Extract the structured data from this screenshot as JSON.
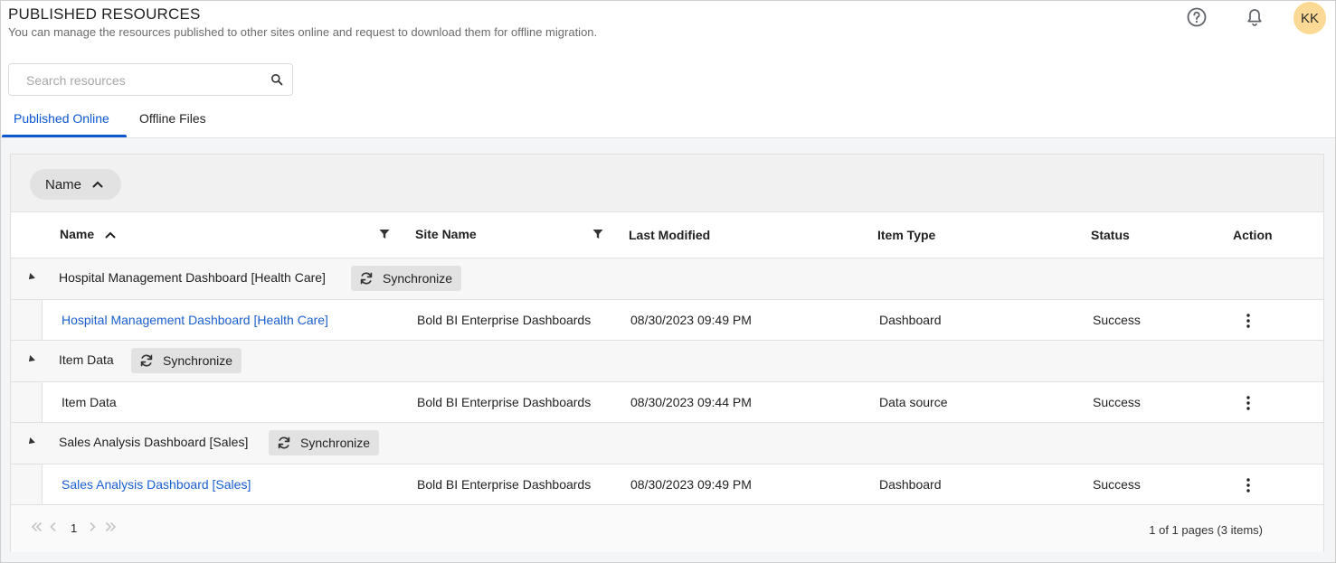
{
  "header": {
    "title": "PUBLISHED RESOURCES",
    "subtitle": "You can manage the resources published to other sites online and request to download them for offline migration.",
    "avatar_initials": "KK"
  },
  "search": {
    "placeholder": "Search resources",
    "value": ""
  },
  "tabs": [
    {
      "label": "Published Online",
      "active": true
    },
    {
      "label": "Offline Files",
      "active": false
    }
  ],
  "grouping": {
    "chip_label": "Name"
  },
  "columns": {
    "name": "Name",
    "site_name": "Site Name",
    "last_modified": "Last Modified",
    "item_type": "Item Type",
    "status": "Status",
    "action": "Action"
  },
  "groups": [
    {
      "title": "Hospital Management Dashboard [Health Care]",
      "sync_label": "Synchronize",
      "item": {
        "name": "Hospital Management Dashboard [Health Care]",
        "site": "Bold BI Enterprise Dashboards",
        "modified": "08/30/2023 09:49 PM",
        "type": "Dashboard",
        "status": "Success"
      }
    },
    {
      "title": "Item Data",
      "sync_label": "Synchronize",
      "item": {
        "name": "Item Data",
        "site": "Bold BI Enterprise Dashboards",
        "modified": "08/30/2023 09:44 PM",
        "type": "Data source",
        "status": "Success"
      }
    },
    {
      "title": "Sales Analysis Dashboard [Sales]",
      "sync_label": "Synchronize",
      "item": {
        "name": "Sales Analysis Dashboard [Sales]",
        "site": "Bold BI Enterprise Dashboards",
        "modified": "08/30/2023 09:49 PM",
        "type": "Dashboard",
        "status": "Success"
      }
    }
  ],
  "pager": {
    "current_page": "1",
    "info": "1 of 1 pages (3 items)"
  },
  "colors": {
    "accent": "#0b57d0",
    "link": "#1a5fd0",
    "avatar_bg": "#fcd995"
  }
}
